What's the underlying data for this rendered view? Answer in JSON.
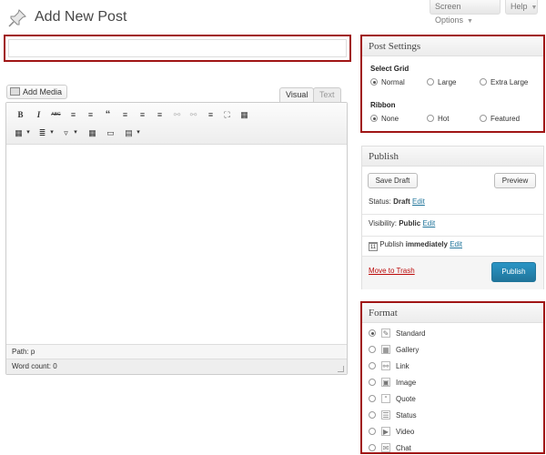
{
  "topbar": {
    "screen_options": "Screen Options",
    "help": "Help",
    "arrow": "▼"
  },
  "page": {
    "title": "Add New Post",
    "title_placeholder": ""
  },
  "editor": {
    "add_media": "Add Media",
    "tab_visual": "Visual",
    "tab_text": "Text",
    "toolbar_row1": [
      "B",
      "I",
      "ABC",
      "≡",
      "≡",
      "“",
      "≡",
      "≡",
      "≡",
      "⚯",
      "⚯",
      "≡",
      "⛶",
      "▦"
    ],
    "toolbar_row2": [
      "▦",
      "▾",
      "≣",
      "▾",
      "▿",
      "▾",
      "▦",
      "▭",
      "▤",
      "▾"
    ],
    "path": "Path: p",
    "word_count": "Word count: 0"
  },
  "post_settings": {
    "title": "Post Settings",
    "select_grid_label": "Select Grid",
    "grid_options": [
      "Normal",
      "Large",
      "Extra Large"
    ],
    "grid_selected": "Normal",
    "ribbon_label": "Ribbon",
    "ribbon_options": [
      "None",
      "Hot",
      "Featured"
    ],
    "ribbon_selected": "None"
  },
  "publish": {
    "title": "Publish",
    "save_draft": "Save Draft",
    "preview": "Preview",
    "status_label": "Status:",
    "status_value": "Draft",
    "edit": "Edit",
    "visibility_label": "Visibility:",
    "visibility_value": "Public",
    "publish_label": "Publish",
    "publish_value": "immediately",
    "move_to_trash": "Move to Trash",
    "publish_button": "Publish",
    "calendar_day": "11"
  },
  "format": {
    "title": "Format",
    "options": [
      {
        "label": "Standard",
        "icon": "pin-icon"
      },
      {
        "label": "Gallery",
        "icon": "gallery-icon"
      },
      {
        "label": "Link",
        "icon": "link-icon"
      },
      {
        "label": "Image",
        "icon": "image-icon"
      },
      {
        "label": "Quote",
        "icon": "quote-icon"
      },
      {
        "label": "Status",
        "icon": "status-icon"
      },
      {
        "label": "Video",
        "icon": "video-icon"
      },
      {
        "label": "Chat",
        "icon": "chat-icon"
      }
    ],
    "selected": "Standard"
  },
  "colors": {
    "highlight_border": "#a01515",
    "link": "#21759b",
    "trash": "#bc0b0b",
    "publish_button": "#21759b"
  }
}
